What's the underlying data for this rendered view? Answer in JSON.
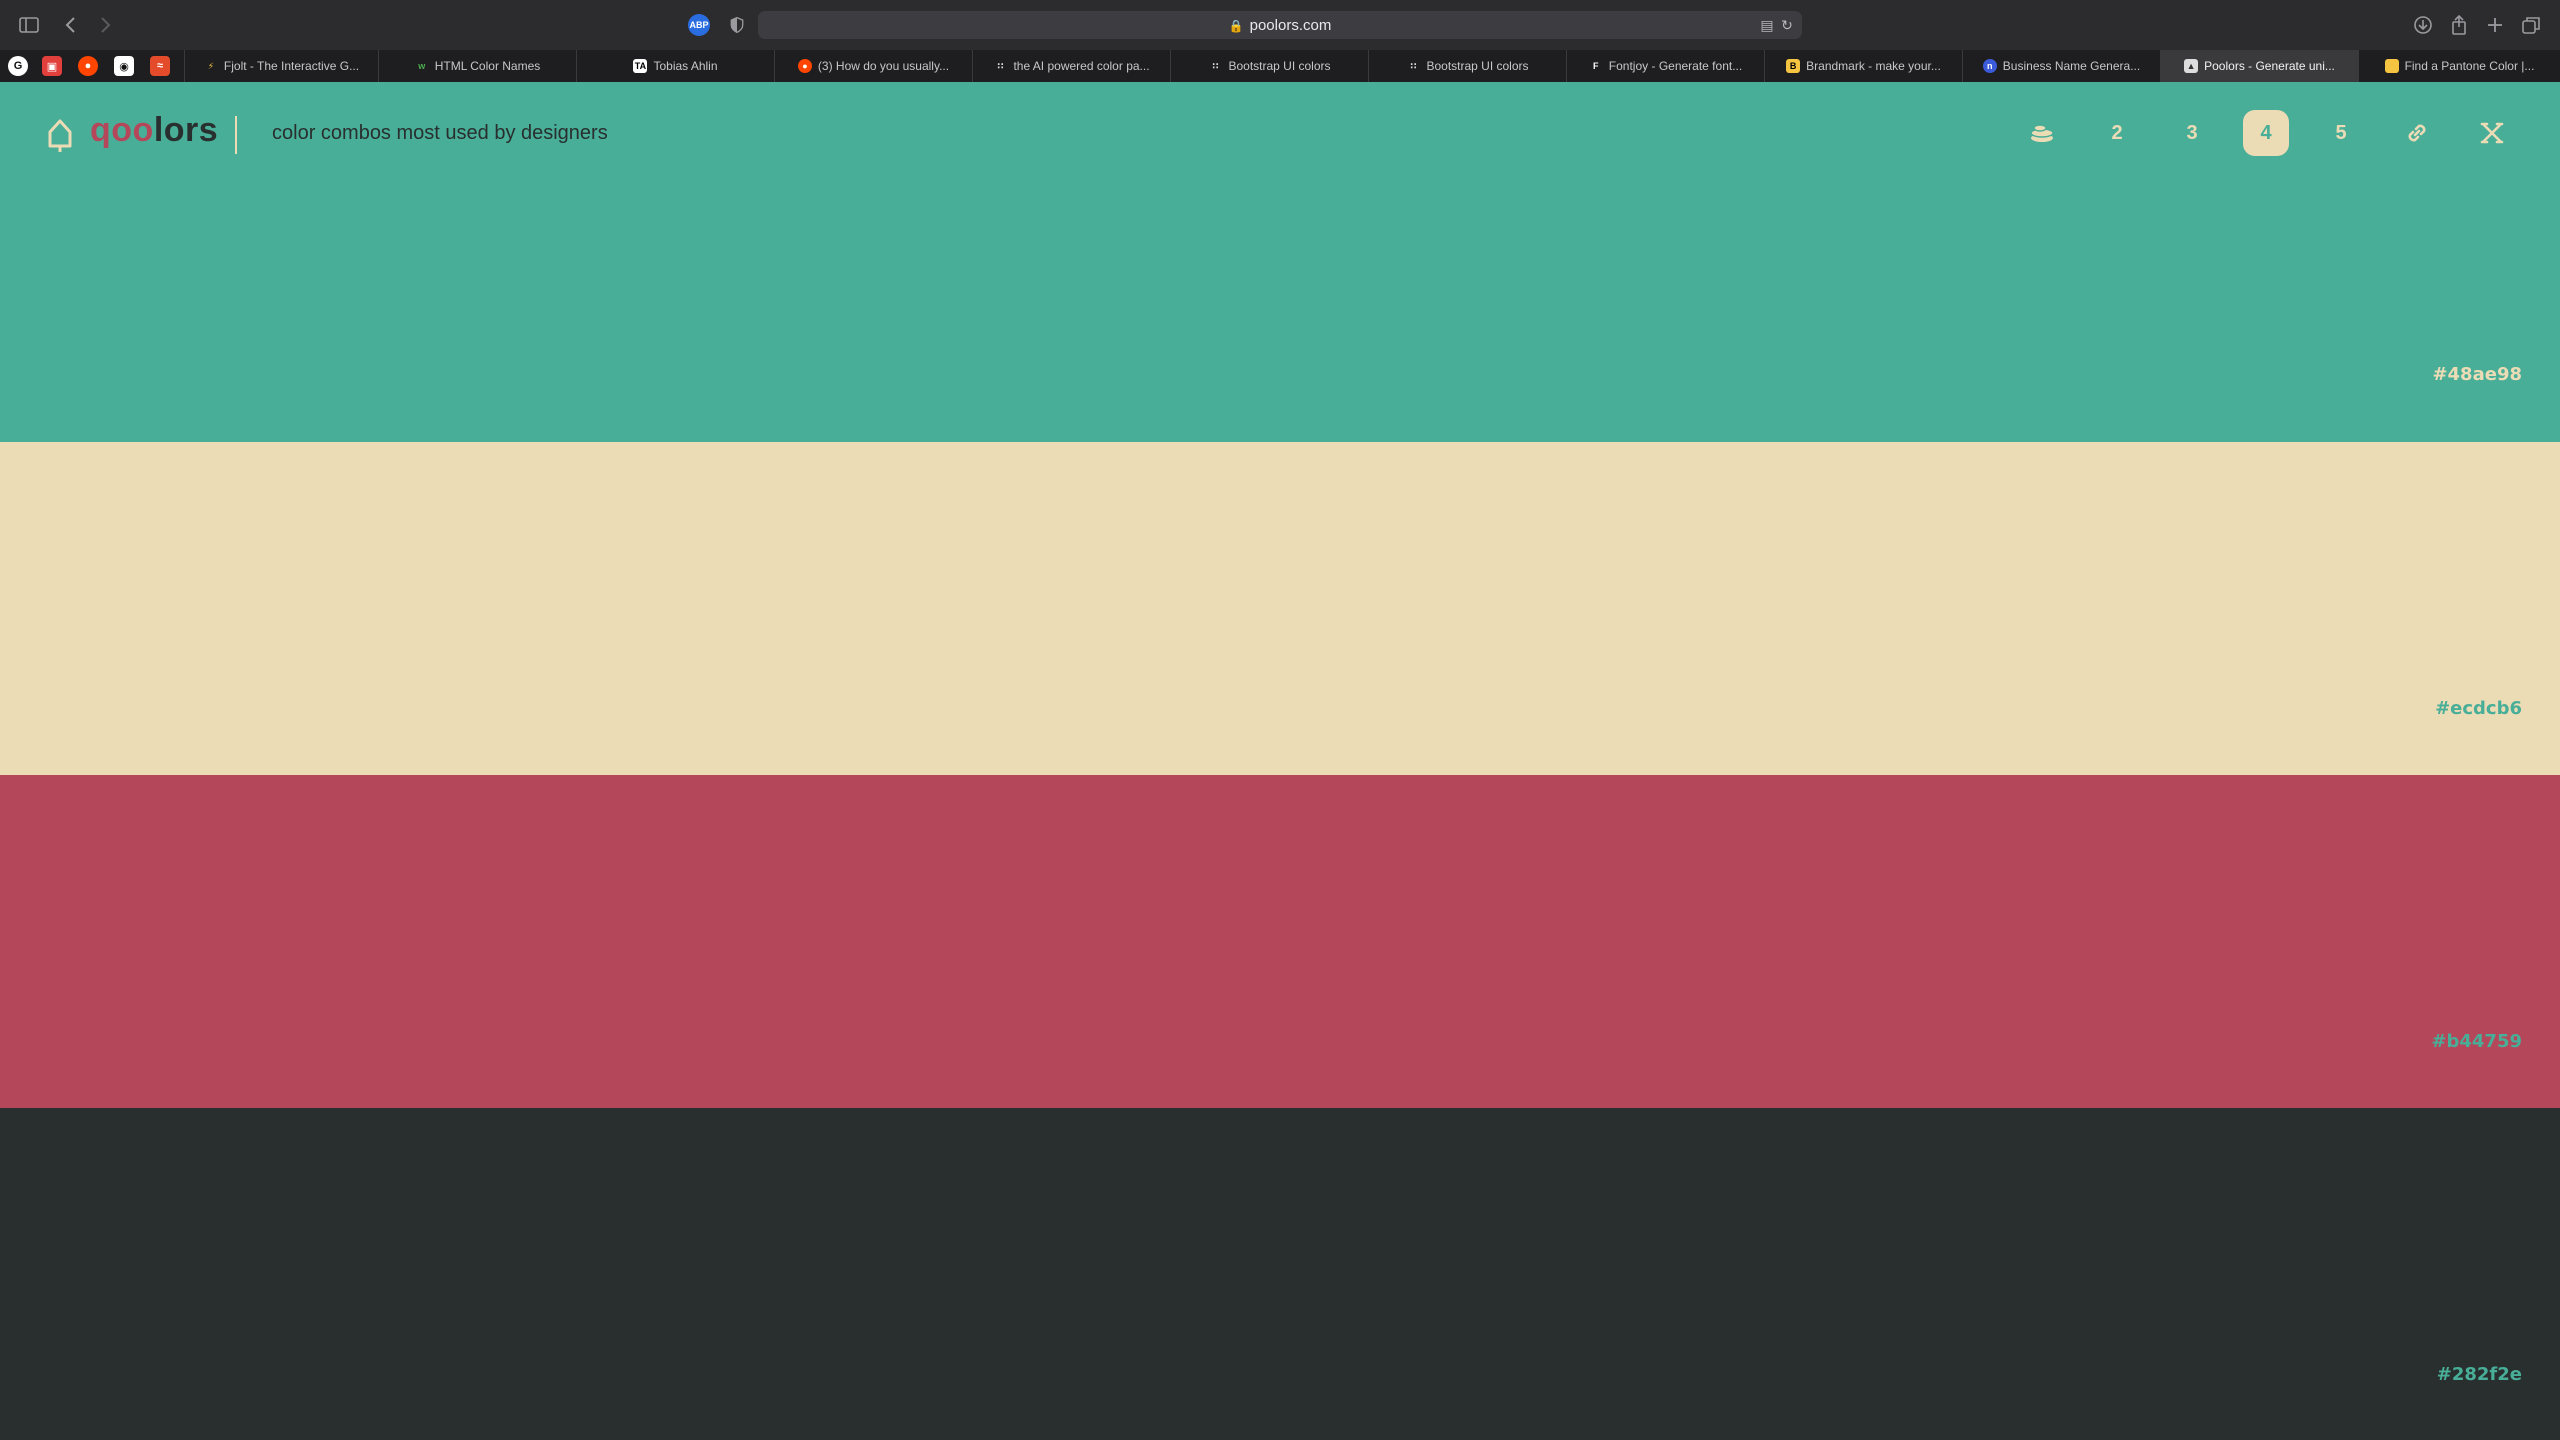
{
  "browser": {
    "url": "poolors.com",
    "tabs": [
      {
        "label": "Fjolt - The Interactive G...",
        "favicon": "lightning",
        "active": false
      },
      {
        "label": "HTML Color Names",
        "favicon": "w3",
        "active": false
      },
      {
        "label": "Tobias Ahlin",
        "favicon": "ta",
        "active": false
      },
      {
        "label": "(3) How do you usually...",
        "favicon": "reddit",
        "active": false
      },
      {
        "label": "the AI powered color pa...",
        "favicon": "dots",
        "active": false
      },
      {
        "label": "Bootstrap UI colors",
        "favicon": "dots",
        "active": false
      },
      {
        "label": "Bootstrap UI colors",
        "favicon": "dots",
        "active": false
      },
      {
        "label": "Fontjoy - Generate font...",
        "favicon": "f",
        "active": false
      },
      {
        "label": "Brandmark - make your...",
        "favicon": "b",
        "active": false
      },
      {
        "label": "Business Name Genera...",
        "favicon": "n",
        "active": false
      },
      {
        "label": "Poolors - Generate uni...",
        "favicon": "poolors",
        "active": true
      },
      {
        "label": "Find a Pantone Color |...",
        "favicon": "pantone",
        "active": false
      }
    ]
  },
  "app": {
    "logo": {
      "part1": "qoo",
      "part2": "lors"
    },
    "tagline": "color combos most used by designers",
    "nav": {
      "counts": [
        "2",
        "3",
        "4",
        "5"
      ],
      "selected": "4",
      "icons": [
        "stack-icon",
        "link-icon",
        "shuffle-icon"
      ]
    }
  },
  "palette": [
    {
      "hex": "#48ae98",
      "label_color": "#ecdcb6"
    },
    {
      "hex": "#ecdcb6",
      "label_color": "#48ae98"
    },
    {
      "hex": "#b44759",
      "label_color": "#48ae98"
    },
    {
      "hex": "#282f2e",
      "label_color": "#48ae98"
    }
  ]
}
